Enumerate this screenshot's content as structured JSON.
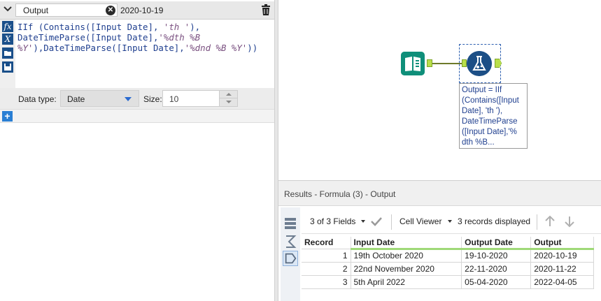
{
  "formula_panel": {
    "output_field": "Output",
    "clear_glyph": "✕",
    "preview_value": "2020-10-19",
    "expression_lines": [
      [
        {
          "t": "IIf (Contains([Input Date], ",
          "c": "fn"
        },
        {
          "t": "'th '",
          "c": "str"
        },
        {
          "t": "),",
          "c": "fn"
        }
      ],
      [
        {
          "t": "DateTimeParse([Input Date],",
          "c": "fn"
        },
        {
          "t": "'%dth %B",
          "c": "str"
        }
      ],
      [
        {
          "t": "%Y'",
          "c": "str"
        },
        {
          "t": "),DateTimeParse([Input Date],",
          "c": "fn"
        },
        {
          "t": "'%dnd %B %Y'",
          "c": "str"
        },
        {
          "t": "))",
          "c": "fn"
        }
      ]
    ],
    "data_type_label": "Data type:",
    "data_type_value": "Date",
    "size_label": "Size:",
    "size_value": "10",
    "add_glyph": "+",
    "tool_icons": [
      "function-icon",
      "variable-icon",
      "open-folder-icon",
      "save-icon"
    ]
  },
  "canvas": {
    "annotation": "Output = IIf\n(Contains([Input\nDate], 'th '),\nDateTimeParse\n([Input Date],'%\ndth %B..."
  },
  "results": {
    "title": "Results - Formula (3) - Output",
    "fields_label": "3 of 3 Fields",
    "cell_viewer_label": "Cell Viewer",
    "records_label": "3 records displayed",
    "columns": [
      "Record",
      "Input Date",
      "Output Date",
      "Output"
    ],
    "rows": [
      [
        "1",
        "19th October 2020",
        "19-10-2020",
        "2020-10-19"
      ],
      [
        "2",
        "22nd November 2020",
        "22-11-2020",
        "2020-11-22"
      ],
      [
        "3",
        "5th April 2022",
        "05-04-2020",
        "2022-04-05"
      ]
    ]
  },
  "colors": {
    "formula_text": "#1f3f8f",
    "string_literal": "#7a5080",
    "input_tool": "#0f8f7a",
    "formula_tool": "#1c4f86",
    "anchor": "#b9df4a",
    "header_underline": "#9fd978"
  }
}
